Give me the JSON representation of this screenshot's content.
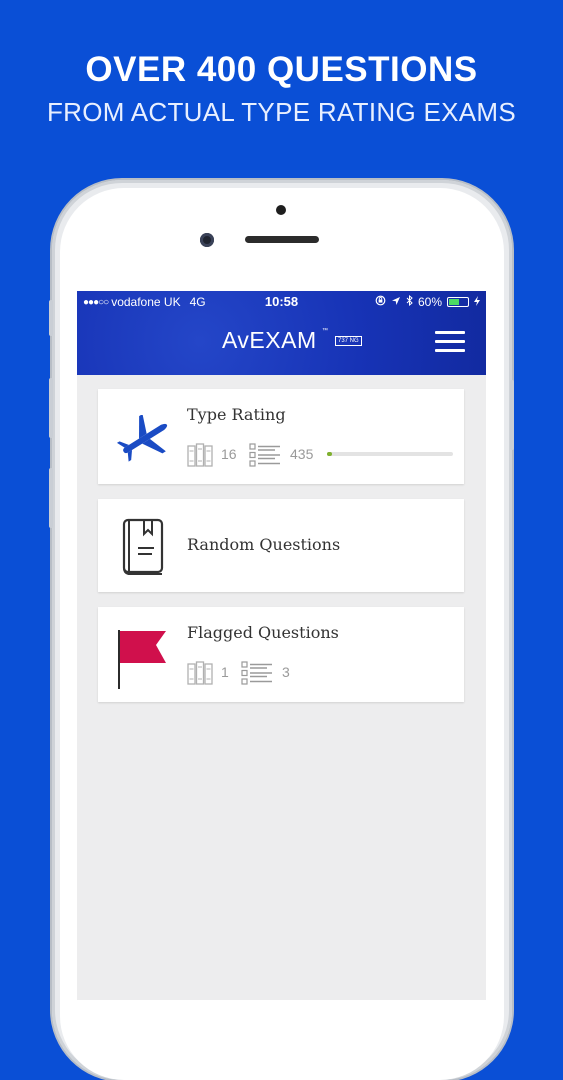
{
  "promo": {
    "headline": "OVER 400 QUESTIONS",
    "subheadline": "FROM ACTUAL TYPE RATING EXAMS"
  },
  "statusbar": {
    "signal_dots": "●●●○○",
    "carrier": "vodafone UK",
    "network": "4G",
    "time": "10:58",
    "battery_percent_label": "60%",
    "battery_level": 0.6
  },
  "navbar": {
    "logo": "AvEXAM",
    "trademark": "™",
    "model_tag": "737 NG",
    "menu_icon": "hamburger-menu-icon"
  },
  "cards": [
    {
      "title": "Type Rating",
      "icon": "airplane-icon",
      "chapters_count": "16",
      "questions_count": "435",
      "progress": 0.04,
      "accent": "#1a4bc4"
    },
    {
      "title": "Random Questions",
      "icon": "book-icon"
    },
    {
      "title": "Flagged Questions",
      "icon": "flag-icon",
      "chapters_count": "1",
      "questions_count": "3",
      "accent": "#d0104c"
    }
  ],
  "colors": {
    "background": "#0a4fd6",
    "navbar": "#1733b6",
    "progress": "#7fb02e"
  }
}
